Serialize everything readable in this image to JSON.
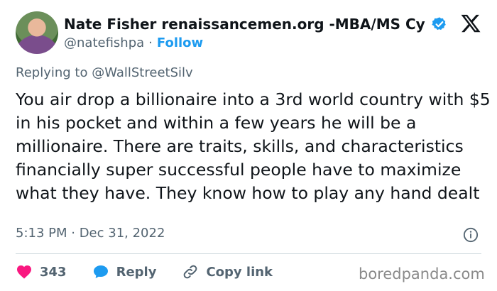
{
  "author": {
    "name": "Nate Fisher renaissancemen.org -MBA/MS Cyb…",
    "handle": "@natefishpa",
    "separator": "·",
    "follow_label": "Follow"
  },
  "tweet": {
    "replying_to": "Replying to @WallStreetSilv",
    "text": "You air drop a billionaire into a 3rd world country with $5 in his pocket and within a few years he will be a millionaire. There are traits, skills, and characteristics financially super successful people have to maximize what they have. They know how to play any hand dealt",
    "timestamp": "5:13 PM · Dec 31, 2022"
  },
  "actions": {
    "likes_count": "343",
    "reply_label": "Reply",
    "copy_link_label": "Copy link"
  },
  "watermark": "boredpanda.com",
  "colors": {
    "verified_blue": "#1d9bf0",
    "like_red": "#f91880",
    "reply_blue": "#1d9bf0",
    "text_gray": "#536471"
  },
  "icons": [
    "verified-badge-icon",
    "x-logo-icon",
    "info-icon",
    "heart-icon",
    "reply-bubble-icon",
    "link-icon"
  ]
}
